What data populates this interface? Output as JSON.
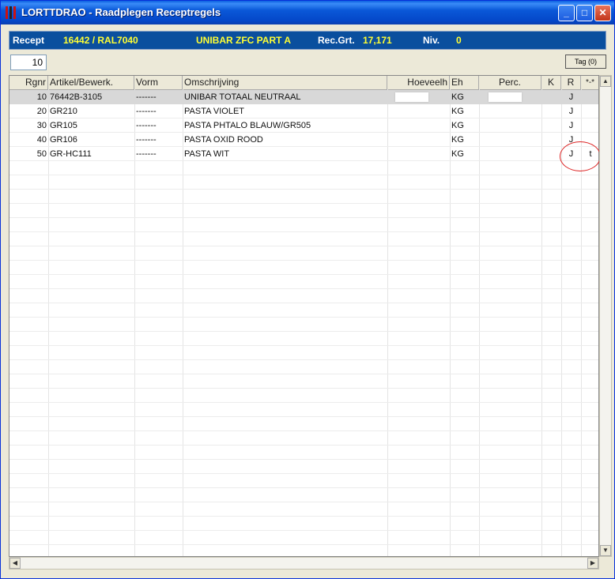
{
  "window": {
    "title": "LORTTDRAO - Raadplegen Receptregels"
  },
  "header": {
    "recept_label": "Recept",
    "recept_value": "16442 / RAL7040",
    "description": "UNIBAR ZFC PART A",
    "recgrt_label": "Rec.Grt.",
    "recgrt_value": "17,171",
    "niv_label": "Niv.",
    "niv_value": "0"
  },
  "toolbar": {
    "row_input": "10",
    "tag_button": "Tag (0)"
  },
  "table": {
    "columns": [
      "Rgnr",
      "Artikel/Bewerk.",
      "Vorm",
      "Omschrijving",
      "Hoeveelh",
      "Eh",
      "Perc.",
      "K",
      "R",
      "*-*"
    ],
    "rows": [
      {
        "rgnr": "10",
        "artikel": "76442B-3105",
        "vorm": "-------",
        "omschrijving": "UNIBAR TOTAAL NEUTRAAL",
        "eh": "KG",
        "r": "J",
        "extra": ""
      },
      {
        "rgnr": "20",
        "artikel": "GR210",
        "vorm": "-------",
        "omschrijving": "PASTA VIOLET",
        "eh": "KG",
        "r": "J",
        "extra": ""
      },
      {
        "rgnr": "30",
        "artikel": "GR105",
        "vorm": "-------",
        "omschrijving": "PASTA PHTALO BLAUW/GR505",
        "eh": "KG",
        "r": "J",
        "extra": ""
      },
      {
        "rgnr": "40",
        "artikel": "GR106",
        "vorm": "-------",
        "omschrijving": "PASTA OXID ROOD",
        "eh": "KG",
        "r": "J",
        "extra": ""
      },
      {
        "rgnr": "50",
        "artikel": "GR-HC111",
        "vorm": "-------",
        "omschrijving": "PASTA WIT",
        "eh": "KG",
        "r": "J",
        "extra": "t"
      }
    ]
  },
  "colors": {
    "header_bg": "#0a4f9e",
    "header_value": "#ffff33",
    "selected_row": "#d8d8d8",
    "annotation": "#dd2222"
  }
}
